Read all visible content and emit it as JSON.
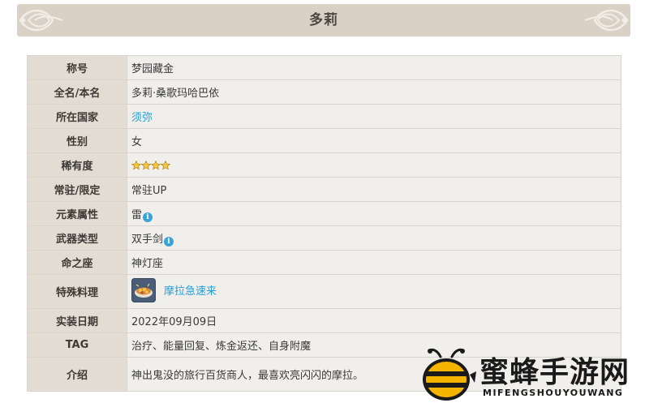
{
  "title": "多莉",
  "rows": [
    {
      "label": "称号",
      "value": "梦园藏金"
    },
    {
      "label": "全名/本名",
      "value": "多莉·桑歌玛哈巴依"
    },
    {
      "label": "所在国家",
      "value": "须弥"
    },
    {
      "label": "性别",
      "value": "女"
    },
    {
      "label": "稀有度",
      "stars": 4
    },
    {
      "label": "常驻/限定",
      "value": "常驻UP"
    },
    {
      "label": "元素属性",
      "value": "雷"
    },
    {
      "label": "武器类型",
      "value": "双手剑"
    },
    {
      "label": "命之座",
      "value": "神灯座"
    },
    {
      "label": "特殊料理",
      "value": "摩拉急速来"
    },
    {
      "label": "实装日期",
      "value": "2022年09月09日"
    },
    {
      "label": "TAG",
      "value": "治疗、能量回复、炼金返还、自身附魔"
    },
    {
      "label": "介绍",
      "value": "神出鬼没的旅行百货商人，最喜欢亮闪闪的摩拉。"
    }
  ],
  "icons": {
    "info": "i"
  },
  "watermark": {
    "name": "蜜蜂手游网",
    "pinyin": "MIFENGSHOUYOUWANG"
  },
  "colors": {
    "link": "#1e9fd6",
    "header_bg": "#d9d1c6",
    "key_bg": "#e2dcd3",
    "value_bg": "#f1efeb"
  }
}
